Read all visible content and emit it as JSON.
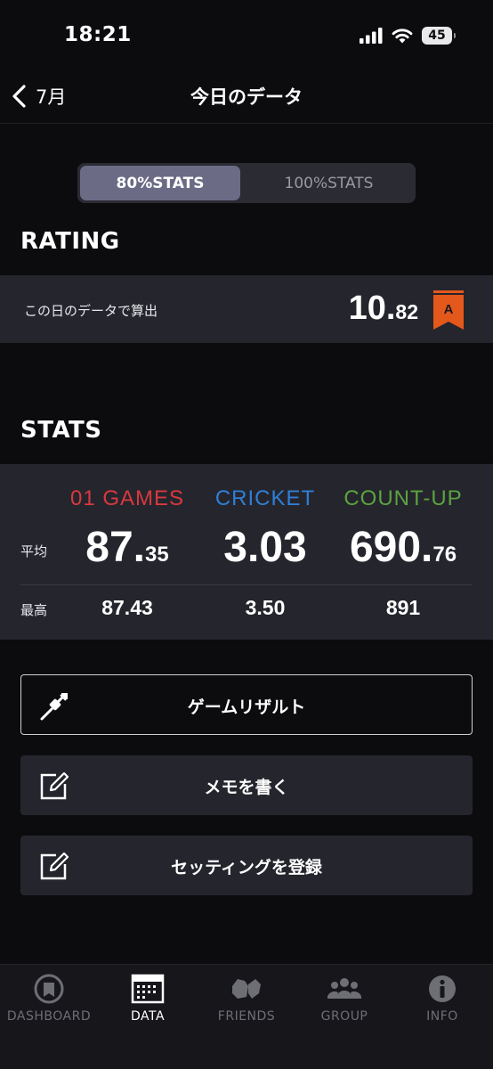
{
  "status": {
    "time": "18:21",
    "battery": "45"
  },
  "nav": {
    "back_label": "7月",
    "title": "今日のデータ"
  },
  "segments": {
    "active": "80%STATS",
    "inactive": "100%STATS"
  },
  "rating": {
    "heading": "RATING",
    "label": "この日のデータで算出",
    "value_int": "10.",
    "value_dec": "82",
    "rank": "A",
    "rank_color": "#e5581b"
  },
  "stats": {
    "heading": "STATS",
    "row_avg_label": "平均",
    "row_max_label": "最高",
    "columns": [
      {
        "name": "01 GAMES",
        "color": "#d9383f",
        "avg_int": "87.",
        "avg_dec": "35",
        "max": "87.43"
      },
      {
        "name": "CRICKET",
        "color": "#2f7fd6",
        "avg_int": "3.03",
        "avg_dec": "",
        "max": "3.50"
      },
      {
        "name": "COUNT-UP",
        "color": "#5ba33f",
        "avg_int": "690.",
        "avg_dec": "76",
        "max": "891"
      }
    ]
  },
  "actions": {
    "game_result": "ゲームリザルト",
    "write_memo": "メモを書く",
    "register_setting": "セッティングを登録"
  },
  "tabs": [
    {
      "label": "DASHBOARD",
      "icon": "dashboard-icon",
      "active": false
    },
    {
      "label": "DATA",
      "icon": "calendar-icon",
      "active": true
    },
    {
      "label": "FRIENDS",
      "icon": "friends-icon",
      "active": false
    },
    {
      "label": "GROUP",
      "icon": "group-icon",
      "active": false
    },
    {
      "label": "INFO",
      "icon": "info-icon",
      "active": false
    }
  ]
}
